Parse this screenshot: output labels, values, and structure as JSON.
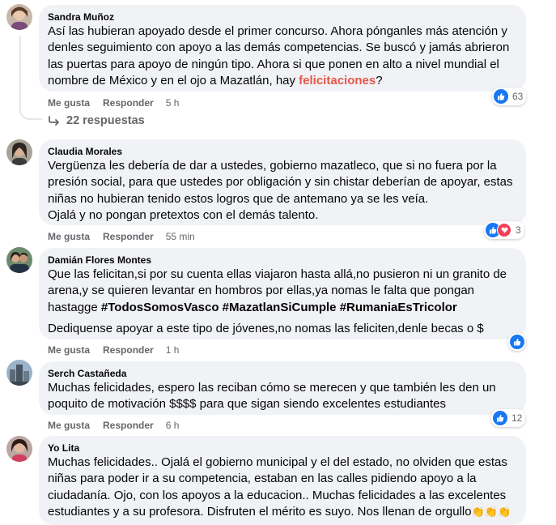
{
  "actions": {
    "like": "Me gusta",
    "reply": "Responder"
  },
  "comments": [
    {
      "author": "Sandra Muñoz",
      "text_before": "Así las hubieran apoyado desde el primer concurso. Ahora pónganles más atención y denles seguimiento con apoyo a las demás competencias. Se buscó y jamás abrieron las puertas para apoyo de ningún tipo. Ahora si que ponen en alto a nivel mundial el nombre de México y en el ojo a Mazatlán, hay ",
      "highlight": "felicitaciones",
      "text_after": "?",
      "time": "5 h",
      "reaction_count": "63",
      "replies_label": "22 respuestas"
    },
    {
      "author": "Claudia Morales",
      "text_line1": "Vergüenza les debería de dar a ustedes, gobierno mazatleco, que si no fuera por la presión social, para que ustedes por obligación y sin chistar deberían de apoyar, estas niñas no hubieran tenido estos logros que de antemano ya se les veía.",
      "text_line2": "Ojalá y no pongan pretextos con el demás talento.",
      "time": "55 min",
      "reaction_count": "3"
    },
    {
      "author": "Damián Flores Montes",
      "text_main": "Que las felicitan,si por su cuenta ellas viajaron hasta allá,no pusieron ni un granito de arena,y se quieren levantar en hombros por ellas,ya nomas le falta que pongan hastagge ",
      "hashtags": "#TodosSomosVasco #MazatlanSiCumple #RumaniaEsTricolor",
      "text_second": "Dediquense apoyar a este tipo de jóvenes,no nomas las feliciten,denle becas o $",
      "time": "1 h"
    },
    {
      "author": "Serch Castañeda",
      "text": "Muchas felicidades, espero las reciban cómo se merecen y que también les den un poquito de motivación $$$$ para que sigan siendo excelentes estudiantes",
      "time": "6 h",
      "reaction_count": "12"
    },
    {
      "author": "Yo Lita",
      "text": "Muchas felicidades.. Ojalá el gobierno municipal y el del estado, no olviden que estas niñas para poder ir a su competencia, estaban en las calles pidiendo apoyo a la ciudadanía. Ojo, con los apoyos a la educacion.. Muchas felicidades a las excelentes estudiantes y a su profesora. Disfruten el mérito es suyo. Nos llenan de orgullo",
      "emoji": "👏👏👏"
    }
  ]
}
